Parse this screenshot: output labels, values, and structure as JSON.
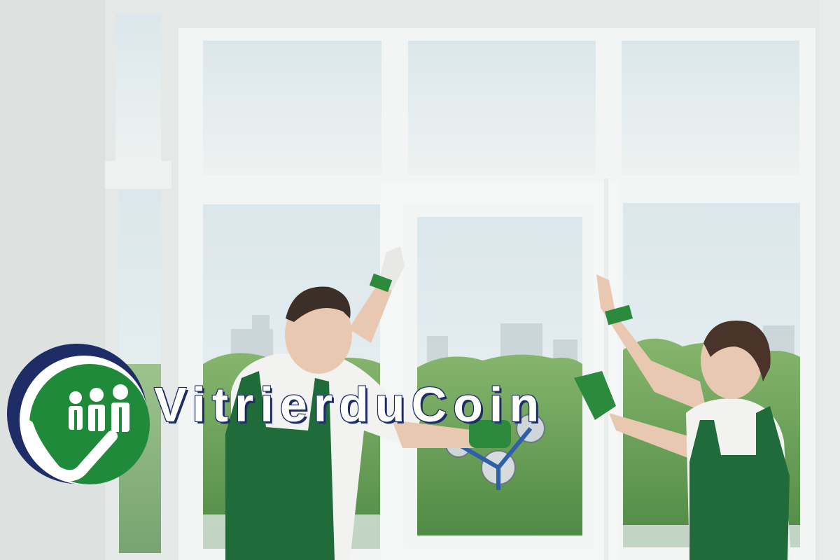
{
  "brand": {
    "name": "VitrierduCoin",
    "logo_icon": "check-mark-with-three-workers-icon",
    "colors": {
      "ring": "#1e2d66",
      "badge": "#1f8a3a",
      "text": "#ffffff"
    }
  },
  "scene": {
    "photo_description_icon": "workers-installing-window-photo",
    "colors": {
      "wall": "#e6e9e8",
      "frame": "#f4f6f5",
      "sky": "#e3ecef",
      "trees": "#6fa35a",
      "overalls": "#1f6b3a",
      "shirt": "#f2f2f0"
    }
  }
}
